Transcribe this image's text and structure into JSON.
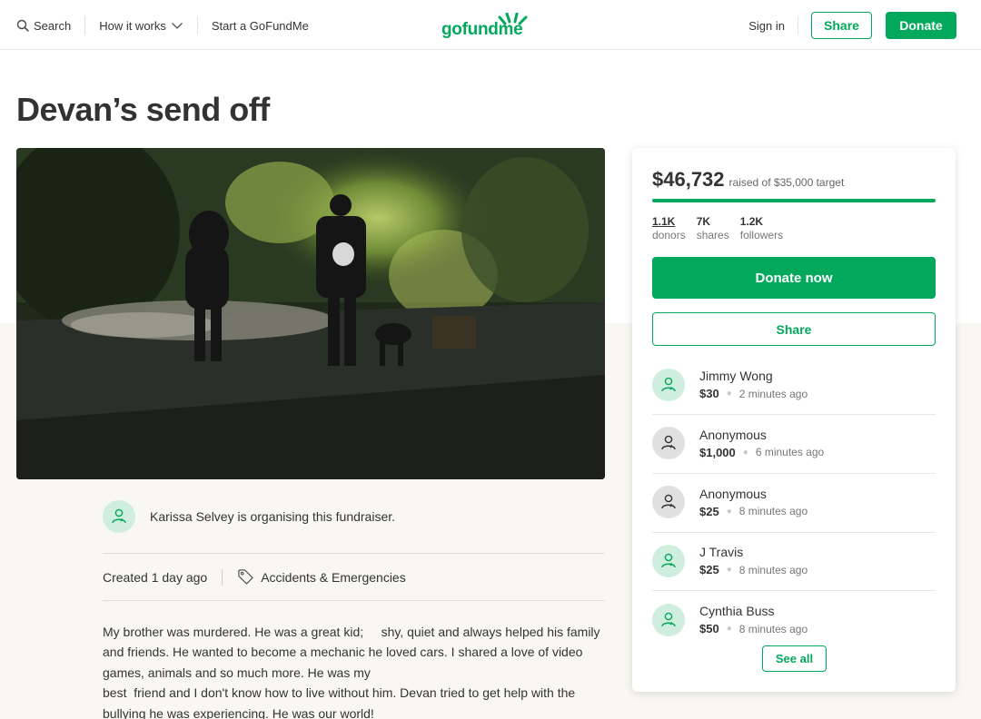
{
  "header": {
    "search_label": "Search",
    "how_it_works_label": "How it works",
    "start_label": "Start a GoFundMe",
    "logo_text": "gofundme",
    "signin_label": "Sign in",
    "share_label": "Share",
    "donate_label": "Donate"
  },
  "campaign": {
    "title": "Devan’s send off",
    "organiser_text": "Karissa Selvey is organising this fundraiser.",
    "created_text": "Created 1 day ago",
    "category": "Accidents & Emergencies",
    "story": "My brother was murdered. He was a great kid;     shy, quiet and always helped his family and friends. He wanted to become a mechanic he loved cars. I shared a love of video games, animals and so much more. He was my\nbest  friend and I don't know how to live without him. Devan tried to get help with the bullying he was experiencing. He was our world!"
  },
  "card": {
    "raised_amount": "$46,732",
    "raised_of_text": "raised of $35,000 target",
    "progress_fraction": 1.0,
    "stats": [
      {
        "value": "1.1K",
        "label": "donors"
      },
      {
        "value": "7K",
        "label": "shares"
      },
      {
        "value": "1.2K",
        "label": "followers"
      }
    ],
    "donate_now_label": "Donate now",
    "share_label": "Share",
    "donations": [
      {
        "name": "Jimmy Wong",
        "amount": "$30",
        "time": "2 minutes ago",
        "avatar": "green"
      },
      {
        "name": "Anonymous",
        "amount": "$1,000",
        "time": "6 minutes ago",
        "avatar": "grey"
      },
      {
        "name": "Anonymous",
        "amount": "$25",
        "time": "8 minutes ago",
        "avatar": "grey"
      },
      {
        "name": "J Travis",
        "amount": "$25",
        "time": "8 minutes ago",
        "avatar": "green"
      },
      {
        "name": "Cynthia Buss",
        "amount": "$50",
        "time": "8 minutes ago",
        "avatar": "green"
      }
    ],
    "see_all_label": "See all"
  },
  "colors": {
    "brand_green": "#02a95c",
    "avatar_green_bg": "#cfeedd",
    "avatar_grey_bg": "#e0e0e0"
  },
  "icons": {
    "search": "search-icon",
    "chevron": "chevron-down-icon",
    "tag": "tag-icon",
    "donor": "donor-heart-icon"
  }
}
